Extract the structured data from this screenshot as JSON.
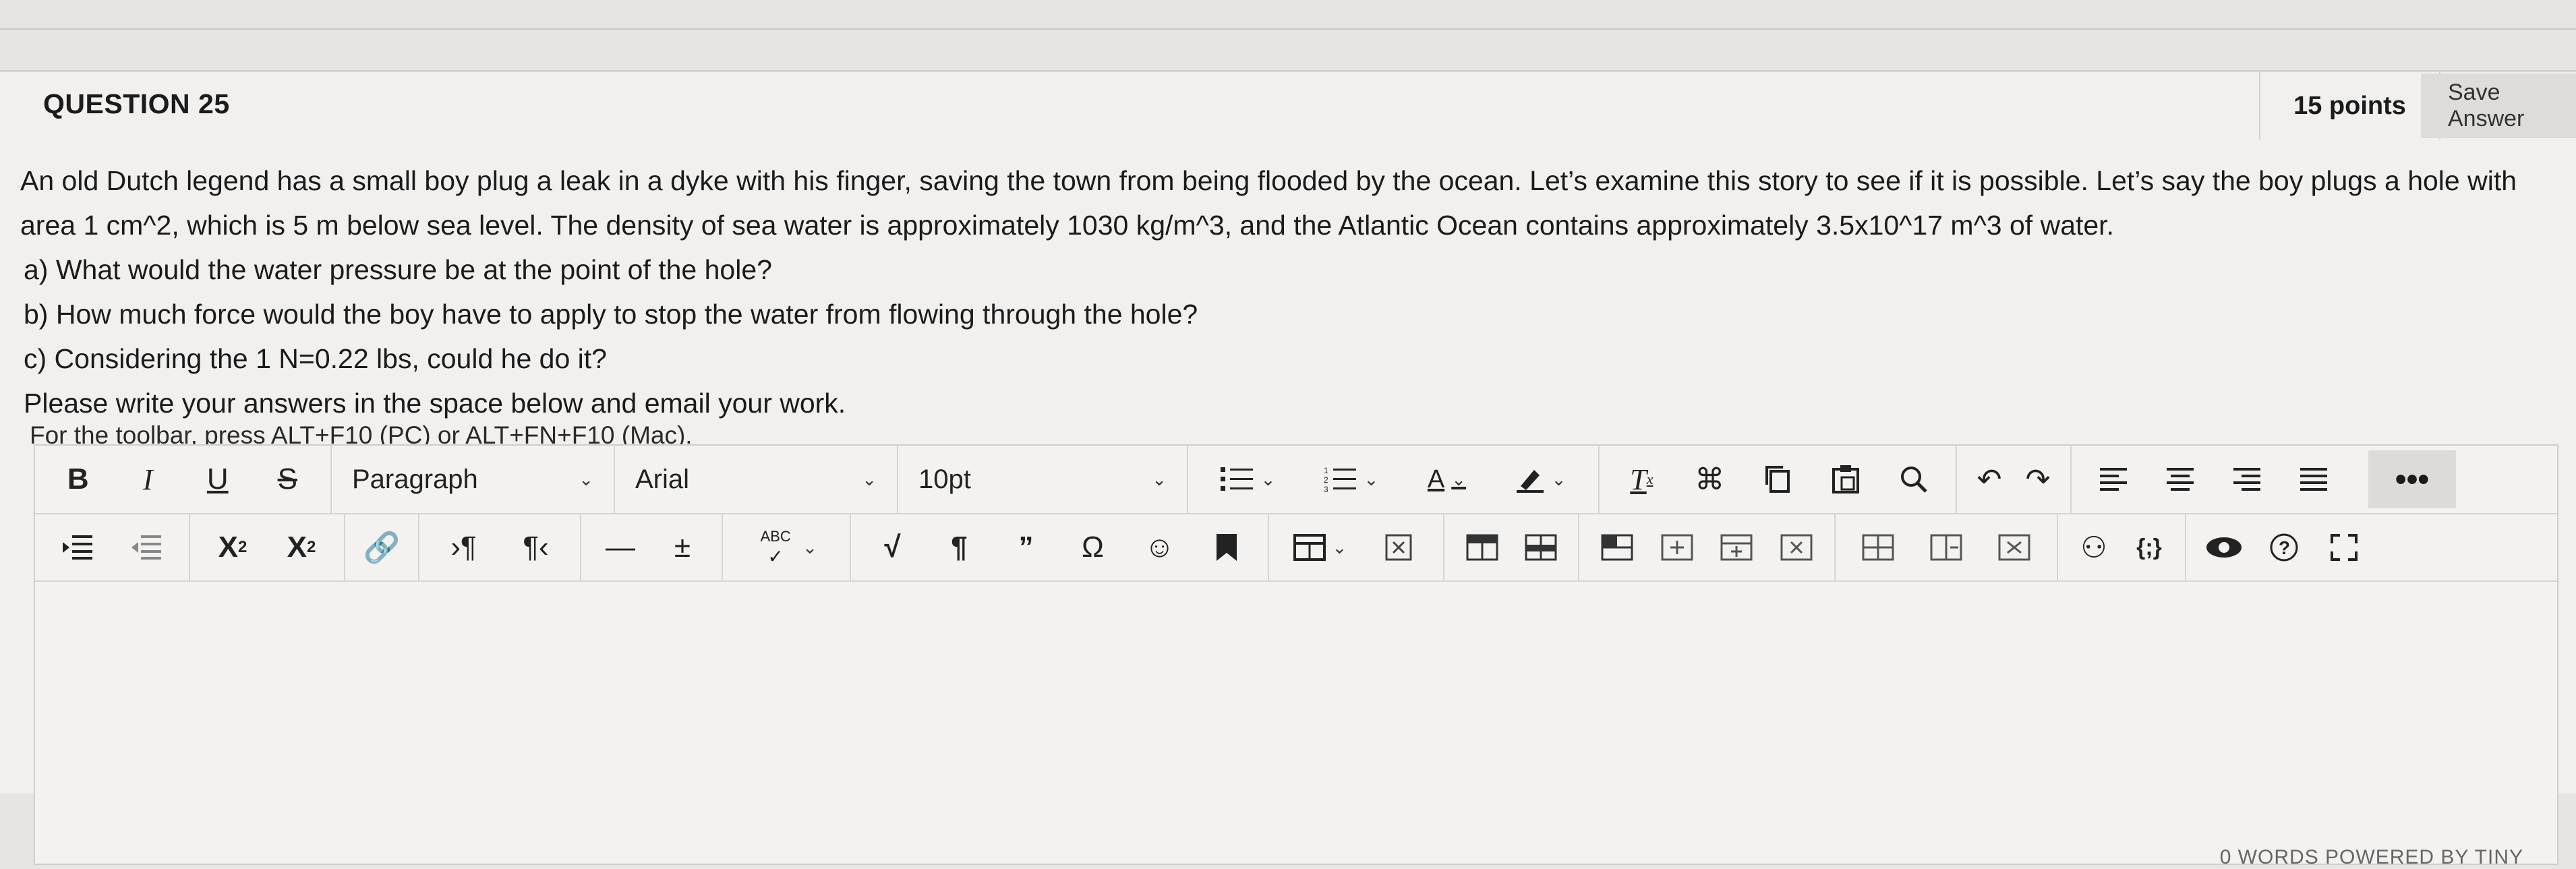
{
  "question": {
    "title": "QUESTION 25",
    "points": "15 points",
    "save_label": "Save Answer",
    "paragraph": "An old Dutch legend has a small boy plug a leak in a dyke with his finger, saving the town from being flooded by the ocean.  Let’s examine this story to see if it is possible.  Let’s say the boy plugs a hole with area 1 cm^2, which is 5 m below sea level.  The density of sea water is approximately 1030 kg/m^3, and the Atlantic Ocean contains approximately 3.5x10^17 m^3 of water.",
    "parts": [
      "a)  What would the water pressure be at the point of the hole?",
      "b)  How much force would the boy have to apply to stop the water from flowing through the hole?",
      "c) Considering the 1 N=0.22 lbs, could he do it?"
    ],
    "instruction": "Please write your answers in the space below and email your work."
  },
  "editor": {
    "toolbar_hint": "For the toolbar, press ALT+F10 (PC) or ALT+FN+F10 (Mac).",
    "block_format": "Paragraph",
    "font_family": "Arial",
    "font_size": "10pt",
    "more_label": "•••",
    "status": "0 WORDS   POWERED BY TINY",
    "icons_row1": [
      "bold-icon",
      "italic-icon",
      "underline-icon",
      "strikethrough-icon",
      "bullet-list-icon",
      "numbered-list-icon",
      "text-color-icon",
      "highlight-icon",
      "clear-formatting-icon",
      "cut-icon",
      "copy-icon",
      "paste-icon",
      "find-icon",
      "undo-icon",
      "redo-icon",
      "align-left-icon",
      "align-center-icon",
      "align-right-icon",
      "justify-icon"
    ],
    "icons_row2": [
      "indent-icon",
      "outdent-icon",
      "superscript-icon",
      "subscript-icon",
      "unlink-icon",
      "ltr-icon",
      "rtl-icon",
      "horizontal-rule-icon",
      "plus-minus-icon",
      "spellcheck-icon",
      "math-icon",
      "paragraph-mark-icon",
      "blockquote-icon",
      "omega-icon",
      "emoji-icon",
      "bookmark-icon",
      "table-icon",
      "delete-table-icon",
      "table-row-icons",
      "accessibility-icon",
      "code-icon",
      "preview-icon",
      "help-icon",
      "fullscreen-icon"
    ]
  }
}
